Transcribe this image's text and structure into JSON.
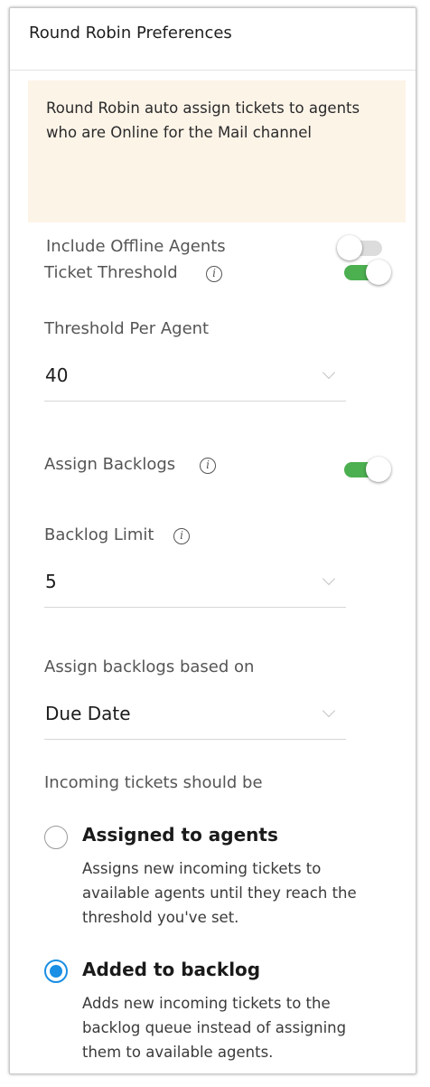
{
  "header": {
    "title": "Round Robin Preferences"
  },
  "info_box": {
    "lines": [
      "Round Robin auto assign tickets to agents",
      "who are Online for the Mail channel"
    ],
    "offline_toggle": {
      "label": "Include Offline Agents",
      "on": false
    }
  },
  "ticket_threshold": {
    "label": "Ticket Threshold",
    "on": true
  },
  "threshold_per_agent": {
    "label": "Threshold Per Agent",
    "value": "40"
  },
  "assign_backlogs": {
    "label": "Assign Backlogs",
    "on": true
  },
  "backlog_limit": {
    "label": "Backlog Limit",
    "value": "5"
  },
  "backlog_basis": {
    "label": "Assign backlogs based on",
    "value": "Due Date"
  },
  "incoming": {
    "label": "Incoming tickets should be",
    "options": [
      {
        "title": "Assigned to agents",
        "desc": [
          "Assigns new incoming tickets to",
          "available agents until they reach the",
          "threshold you've set."
        ],
        "selected": false
      },
      {
        "title": "Added to backlog",
        "desc": [
          "Adds new incoming tickets to the",
          "backlog queue instead of assigning",
          "them to available agents."
        ],
        "selected": true
      }
    ]
  },
  "colors": {
    "toggle_on": "#4caf50",
    "radio_selected": "#1a8fe3",
    "info_bg": "#fdf4e8"
  },
  "icons": [
    "info-icon",
    "chevron-down-icon"
  ]
}
